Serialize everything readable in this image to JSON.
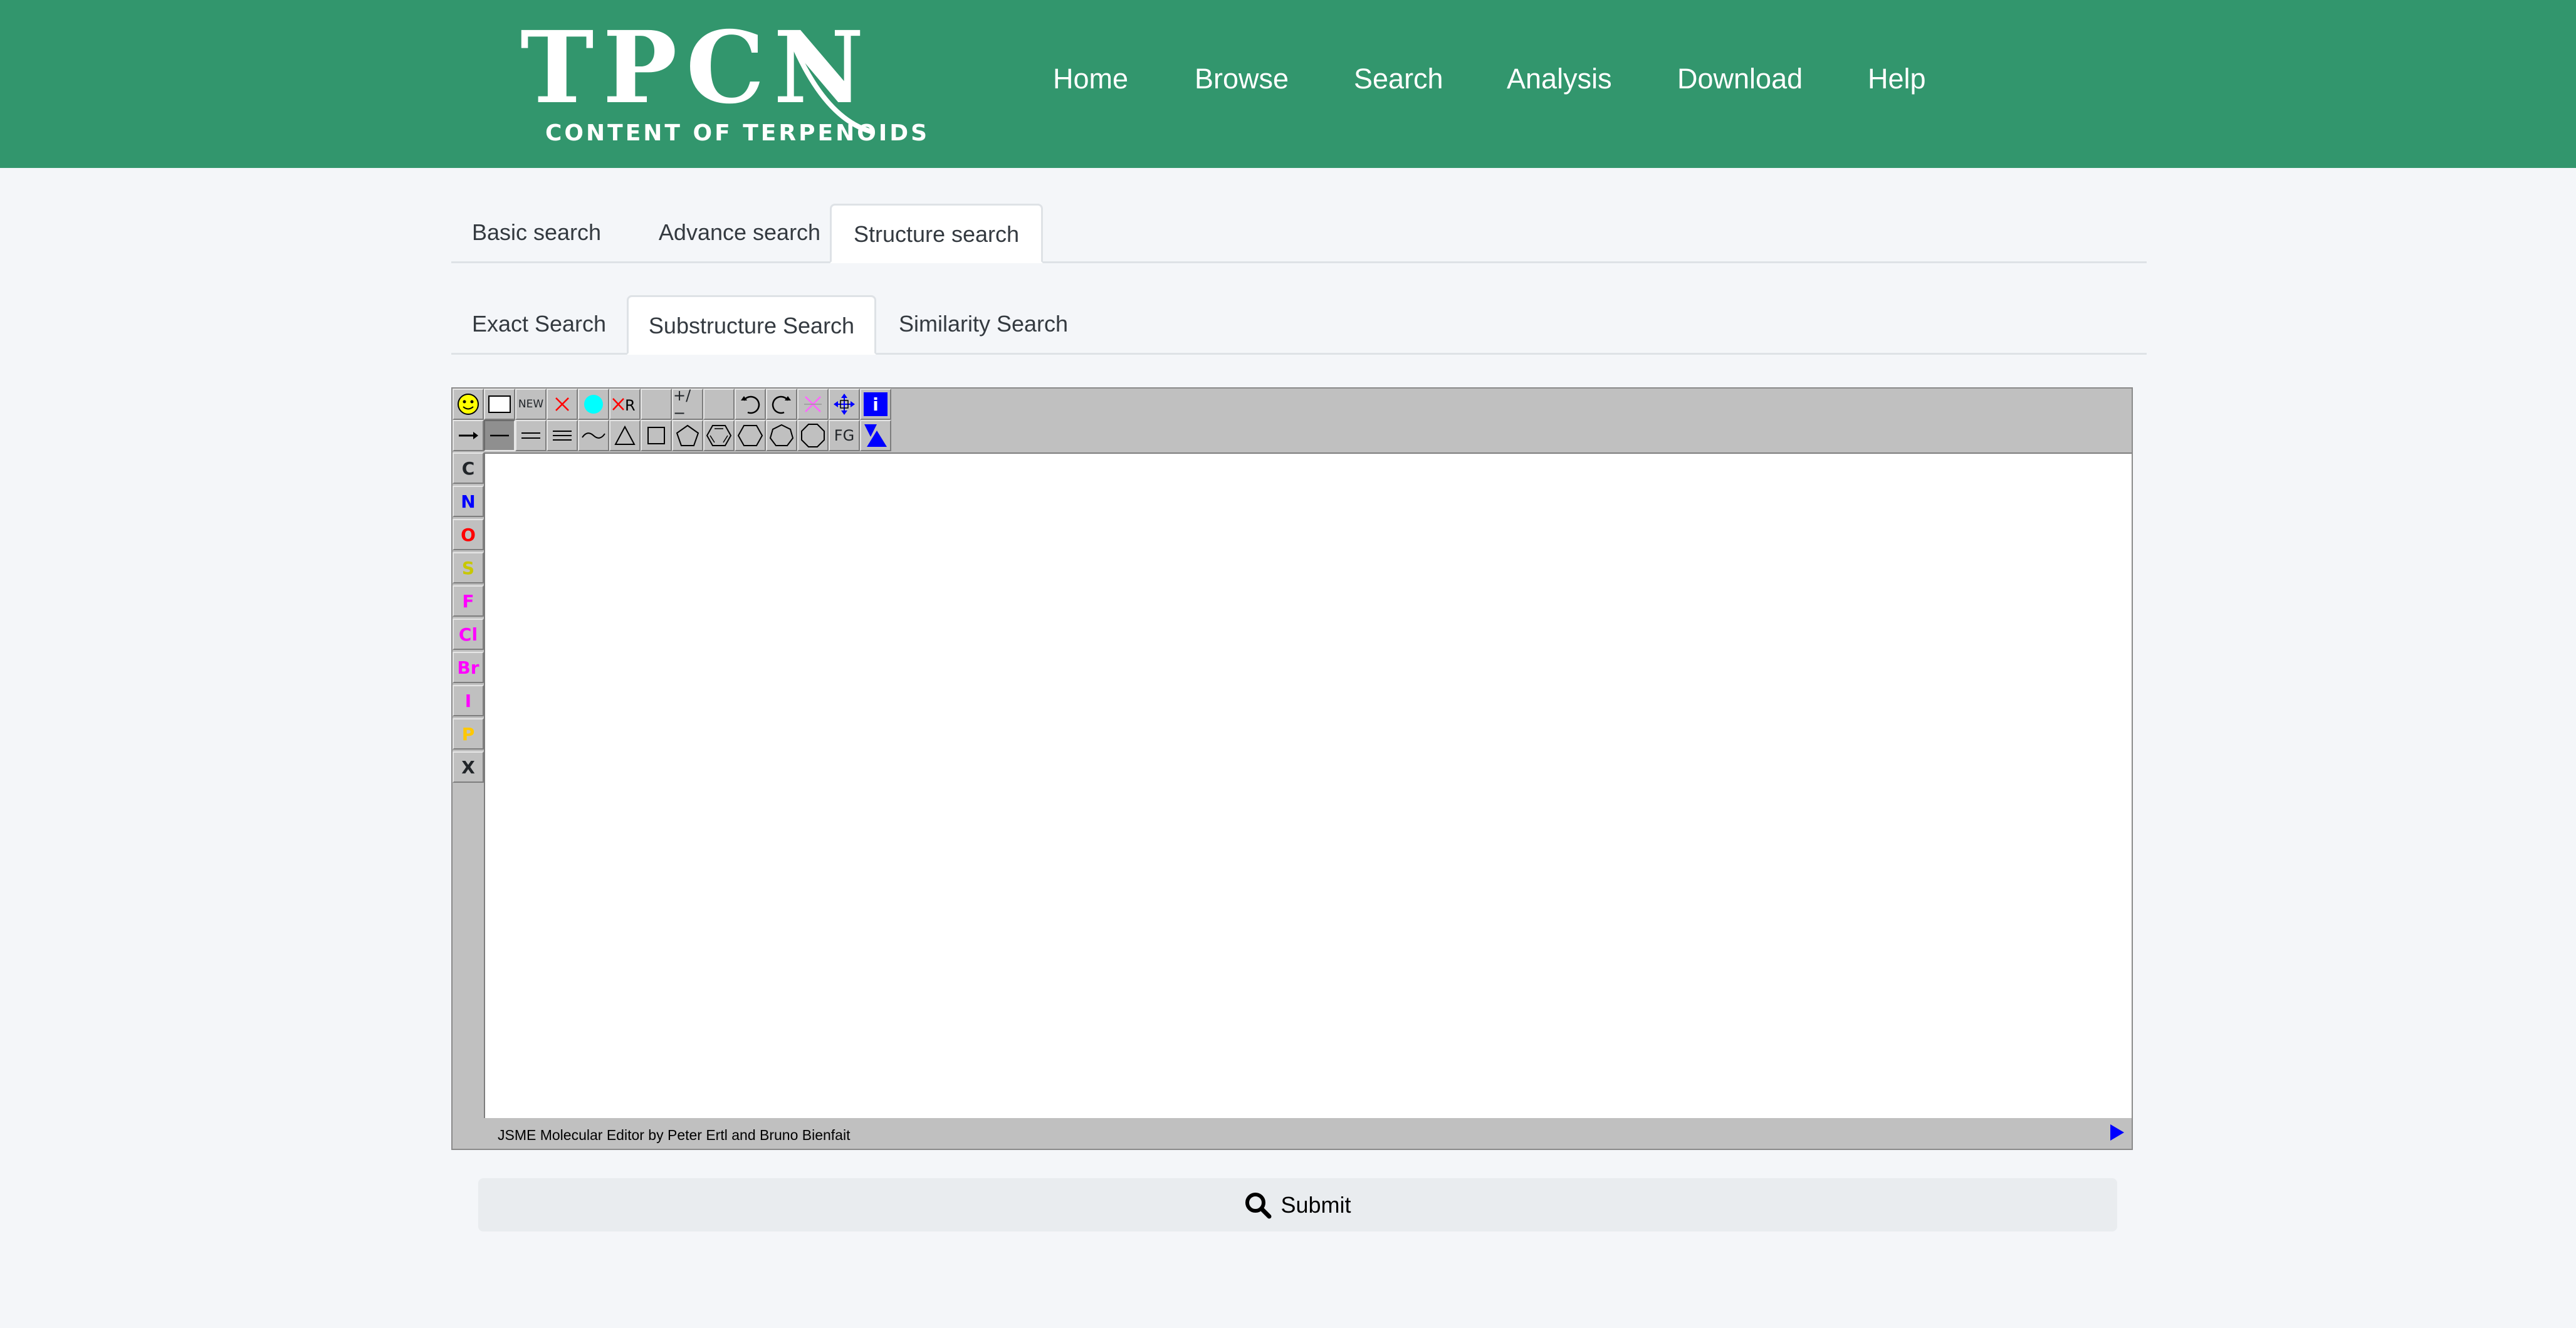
{
  "header": {
    "logo_title": "TPCN",
    "logo_subtitle": "CONTENT OF TERPENOIDS",
    "bg_color": "#32966d",
    "nav": [
      {
        "label": "Home"
      },
      {
        "label": "Browse"
      },
      {
        "label": "Search"
      },
      {
        "label": "Analysis"
      },
      {
        "label": "Download"
      },
      {
        "label": "Help"
      }
    ]
  },
  "search_tabs": {
    "items": [
      {
        "label": "Basic search",
        "active": false
      },
      {
        "label": "Advance search",
        "active": false
      },
      {
        "label": "Structure search",
        "active": true
      }
    ]
  },
  "structure_tabs": {
    "items": [
      {
        "label": "Exact Search",
        "active": false
      },
      {
        "label": "Substructure Search",
        "active": true
      },
      {
        "label": "Similarity Search",
        "active": false
      }
    ]
  },
  "editor": {
    "toolbar_top": [
      {
        "icon": "smiley-icon"
      },
      {
        "icon": "rectangle-icon"
      },
      {
        "icon": "new-text",
        "label": "NEW"
      },
      {
        "icon": "delete-x-icon"
      },
      {
        "icon": "cyan-circle-icon"
      },
      {
        "icon": "delete-r-group-icon",
        "label": "R"
      },
      {
        "icon": "blank-icon"
      },
      {
        "icon": "charge-plus-minus-icon",
        "label": "+/−"
      },
      {
        "icon": "blank-icon"
      },
      {
        "icon": "undo-icon"
      },
      {
        "icon": "redo-icon"
      },
      {
        "icon": "delete-bond-x-icon"
      },
      {
        "icon": "move-arrows-icon"
      },
      {
        "icon": "info-icon",
        "label": "i"
      }
    ],
    "toolbar_bottom": [
      {
        "icon": "chain-icon"
      },
      {
        "icon": "single-bond-icon"
      },
      {
        "icon": "double-bond-icon"
      },
      {
        "icon": "triple-bond-icon"
      },
      {
        "icon": "wavy-bond-icon"
      },
      {
        "icon": "triangle-ring-icon"
      },
      {
        "icon": "square-ring-icon"
      },
      {
        "icon": "pentagon-ring-icon"
      },
      {
        "icon": "benzene-ring-icon"
      },
      {
        "icon": "hexagon-ring-icon"
      },
      {
        "icon": "heptagon-ring-icon"
      },
      {
        "icon": "octagon-ring-icon"
      },
      {
        "icon": "fg-text",
        "label": "FG"
      },
      {
        "icon": "blue-triangles-icon"
      }
    ],
    "atoms": [
      {
        "label": "C",
        "color": "#000000"
      },
      {
        "label": "N",
        "color": "#0000ff"
      },
      {
        "label": "O",
        "color": "#ff0000"
      },
      {
        "label": "S",
        "color": "#c8c800"
      },
      {
        "label": "F",
        "color": "#ff00ff"
      },
      {
        "label": "Cl",
        "color": "#ff00ff"
      },
      {
        "label": "Br",
        "color": "#ff00ff"
      },
      {
        "label": "I",
        "color": "#ff00ff"
      },
      {
        "label": "P",
        "color": "#ffc800"
      },
      {
        "label": "X",
        "color": "#000000"
      }
    ],
    "status_text": "JSME Molecular Editor by Peter Ertl and Bruno Bienfait"
  },
  "submit": {
    "label": "Submit",
    "icon": "search-icon"
  }
}
